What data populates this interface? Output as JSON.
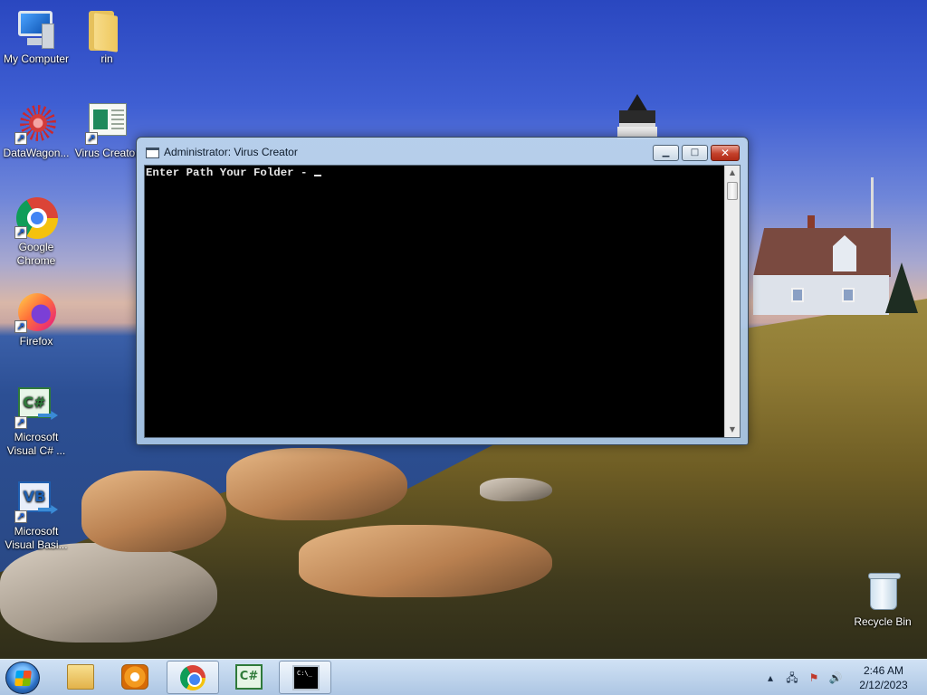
{
  "desktop_icons": {
    "my_computer": "My Computer",
    "rin": "rin",
    "datawagon": "DataWagon...",
    "virus_creator": "Virus Creator",
    "chrome": "Google Chrome",
    "firefox": "Firefox",
    "visual_csharp": "Microsoft Visual C# ...",
    "visual_basic": "Microsoft Visual Basi...",
    "recycle_bin": "Recycle Bin"
  },
  "console": {
    "title": "Administrator:  Virus Creator",
    "prompt": "Enter Path Your Folder - "
  },
  "taskbar": {
    "console_icon_text": "C:\\_",
    "csharp_icon_text": "C#"
  },
  "tray": {
    "time": "2:46 AM",
    "date": "2/12/2023"
  },
  "icons": {
    "start": "windows-logo-icon",
    "close": "close-icon",
    "maximize": "maximize-icon",
    "minimize": "minimize-icon",
    "show_hidden": "chevron-up-icon",
    "network": "network-icon",
    "action_center": "flag-icon",
    "volume": "speaker-icon"
  }
}
